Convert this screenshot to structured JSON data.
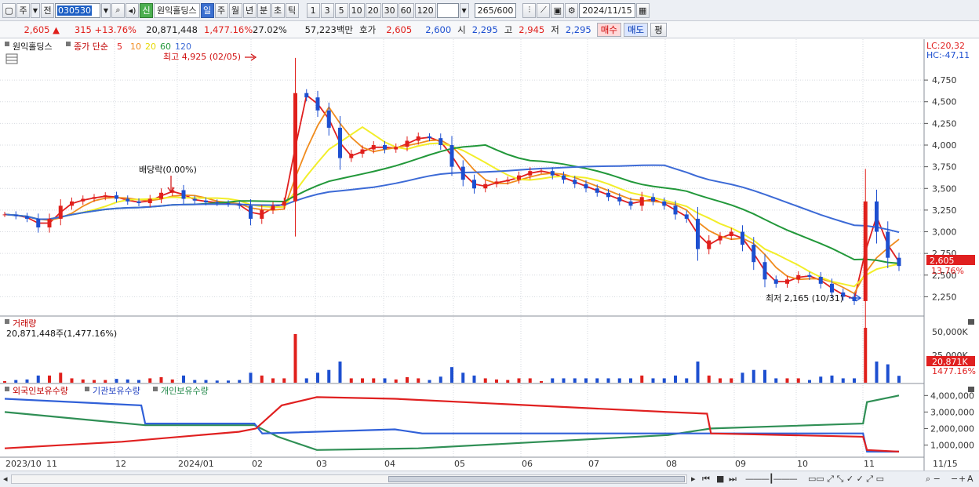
{
  "toolbar": {
    "type_sel": "주",
    "scope_sel": "전",
    "code": "030530",
    "name_badge": "신",
    "stock_name": "원익홀딩스",
    "periods": [
      "일",
      "주",
      "월",
      "년",
      "분",
      "초",
      "틱"
    ],
    "active_period": "일",
    "intervals": [
      "1",
      "3",
      "5",
      "10",
      "20",
      "30",
      "60",
      "120"
    ],
    "bar_count": "265",
    "bar_max": "/600",
    "date": "2024/11/15"
  },
  "quote": {
    "price": "2,605",
    "arrow": "▲",
    "change": "315",
    "change_pct": "+13.76%",
    "volume": "20,871,448",
    "vol_ratio": "1,477.16%",
    "turnover": "27.02%",
    "amount": "57,223백만",
    "hoga_label": "호가",
    "ask": "2,605",
    "bid": "2,600",
    "open_label": "시",
    "open": "2,295",
    "high_label": "고",
    "high": "2,945",
    "low_label": "저",
    "low": "2,295",
    "buy_btn": "매수",
    "sell_btn": "매도",
    "avg_btn": "평"
  },
  "legend": {
    "name": "원익홀딩스",
    "ma_label": "종가 단순",
    "ma_periods": [
      "5",
      "10",
      "20",
      "60",
      "120"
    ]
  },
  "right_info": {
    "lc": "LC:20,32",
    "hc": "HC:-47,11"
  },
  "annotations": {
    "high": "최고 4,925 (02/05)",
    "low": "최저 2,165 (10/31)",
    "dividend": "배당락(0.00%)"
  },
  "price_axis": {
    "ticks": [
      "4,750",
      "4,500",
      "4,250",
      "4,000",
      "3,750",
      "3,500",
      "3,250",
      "3,000",
      "2,750",
      "2,500",
      "2,250"
    ],
    "current": "2,605",
    "current_pct": "13.76%"
  },
  "volume_panel": {
    "title": "거래량",
    "value": "20,871,448주(1,477.16%)",
    "ticks": [
      "50,000K",
      "25,000K"
    ],
    "current": "20,871K",
    "current_pct": "1477.16%"
  },
  "holdings_panel": {
    "legend": [
      "외국인보유수량",
      "기관보유수량",
      "개인보유수량"
    ],
    "ticks": [
      "4,000,000",
      "3,000,000",
      "2,000,000",
      "1,000,000"
    ]
  },
  "x_axis": {
    "labels": [
      "2023/10",
      "11",
      "12",
      "2024/01",
      "02",
      "03",
      "04",
      "05",
      "06",
      "07",
      "08",
      "09",
      "10",
      "11",
      "11/15"
    ]
  },
  "colors": {
    "up": "#e0201c",
    "down": "#1d4fd0",
    "ma5": "#e02020",
    "ma10": "#f08c1e",
    "ma20": "#f2ee2a",
    "ma60": "#22983a",
    "ma120": "#3c6ad6"
  },
  "chart_data": {
    "type": "candlestick",
    "title": "",
    "x_range": [
      "2023-10-11",
      "2024-11-15"
    ],
    "y_range": [
      2165,
      4925
    ],
    "series": [
      {
        "name": "종가",
        "values": [
          3200,
          3180,
          3150,
          3050,
          3150,
          3300,
          3350,
          3380,
          3400,
          3420,
          3380,
          3350,
          3330,
          3380,
          3450,
          3480,
          3380,
          3360,
          3340,
          3330,
          3320,
          3300,
          3150,
          3250,
          3300,
          3350,
          4600,
          4550,
          4400,
          4200,
          3850,
          3900,
          3950,
          4000,
          3950,
          3980,
          4050,
          4100,
          4080,
          4000,
          3750,
          3600,
          3500,
          3550,
          3580,
          3600,
          3650,
          3700,
          3700,
          3650,
          3600,
          3550,
          3500,
          3450,
          3400,
          3350,
          3300,
          3400,
          3350,
          3300,
          3200,
          3150,
          2800,
          2900,
          2950,
          3000,
          2850,
          2650,
          2450,
          2400,
          2450,
          2500,
          2480,
          2400,
          2300,
          2250,
          2200,
          3350,
          3000,
          2700,
          2605
        ]
      }
    ]
  }
}
